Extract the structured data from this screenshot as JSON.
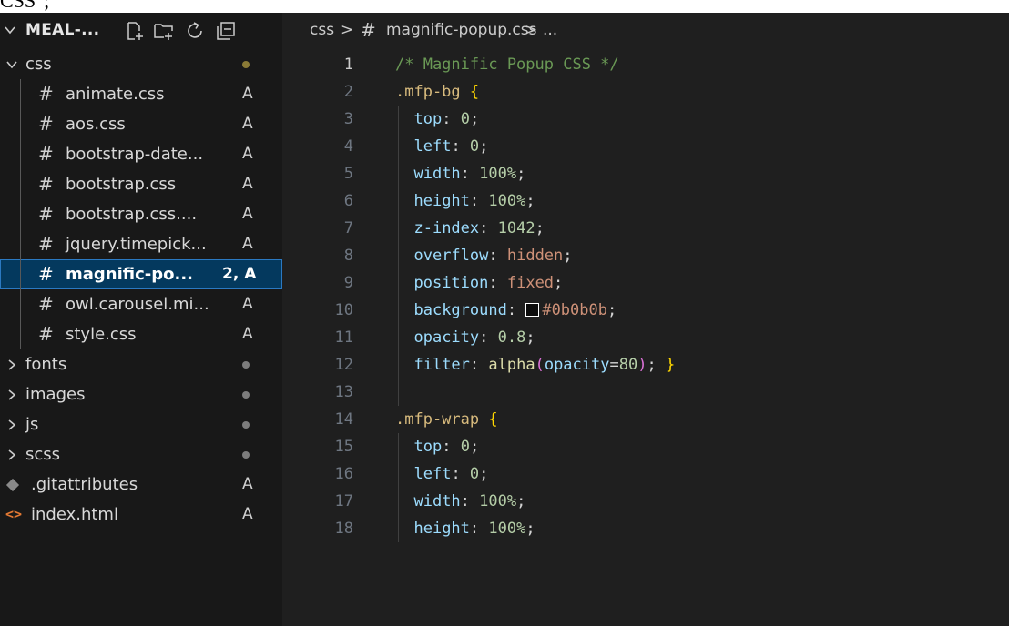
{
  "top_strip_text": "CSS\";",
  "explorer": {
    "title": "MEAL-...",
    "items": [
      {
        "kind": "folder-open",
        "name": "css",
        "status": "dot-modified"
      },
      {
        "kind": "file",
        "name": "animate.css",
        "badge": "A"
      },
      {
        "kind": "file",
        "name": "aos.css",
        "badge": "A"
      },
      {
        "kind": "file",
        "name": "bootstrap-date...",
        "badge": "A"
      },
      {
        "kind": "file",
        "name": "bootstrap.css",
        "badge": "A"
      },
      {
        "kind": "file",
        "name": "bootstrap.css....",
        "badge": "A"
      },
      {
        "kind": "file",
        "name": "jquery.timepick...",
        "badge": "A"
      },
      {
        "kind": "file",
        "name": "magnific-po...",
        "badge": "2, A",
        "selected": true
      },
      {
        "kind": "file",
        "name": "owl.carousel.mi...",
        "badge": "A"
      },
      {
        "kind": "file",
        "name": "style.css",
        "badge": "A"
      },
      {
        "kind": "folder",
        "name": "fonts",
        "status": "dot"
      },
      {
        "kind": "folder",
        "name": "images",
        "status": "dot"
      },
      {
        "kind": "folder",
        "name": "js",
        "status": "dot"
      },
      {
        "kind": "folder",
        "name": "scss",
        "status": "dot"
      },
      {
        "kind": "root-file",
        "name": ".gitattributes",
        "badge": "A",
        "icon": "git-icon"
      },
      {
        "kind": "root-file",
        "name": "index.html",
        "badge": "A",
        "icon": "html-icon"
      }
    ],
    "hash_glyph": "#"
  },
  "breadcrumb": {
    "folder": "css",
    "sep": ">",
    "hash": "#",
    "file": "magnific-popup.css",
    "tail": "..."
  },
  "editor": {
    "active_line": 1,
    "lines": [
      {
        "n": "1",
        "tokens": [
          [
            "t-comment",
            "/* Magnific Popup CSS */"
          ]
        ]
      },
      {
        "n": "2",
        "tokens": [
          [
            "t-sel",
            ".mfp-bg"
          ],
          [
            "t-punc",
            " "
          ],
          [
            "t-brace",
            "{"
          ]
        ]
      },
      {
        "n": "3",
        "tokens": [
          [
            "t-punc",
            "  "
          ],
          [
            "t-prop",
            "top"
          ],
          [
            "t-punc",
            ": "
          ],
          [
            "t-num",
            "0"
          ],
          [
            "t-punc",
            ";"
          ]
        ]
      },
      {
        "n": "4",
        "tokens": [
          [
            "t-punc",
            "  "
          ],
          [
            "t-prop",
            "left"
          ],
          [
            "t-punc",
            ": "
          ],
          [
            "t-num",
            "0"
          ],
          [
            "t-punc",
            ";"
          ]
        ]
      },
      {
        "n": "5",
        "tokens": [
          [
            "t-punc",
            "  "
          ],
          [
            "t-prop",
            "width"
          ],
          [
            "t-punc",
            ": "
          ],
          [
            "t-num",
            "100%"
          ],
          [
            "t-punc",
            ";"
          ]
        ]
      },
      {
        "n": "6",
        "tokens": [
          [
            "t-punc",
            "  "
          ],
          [
            "t-prop",
            "height"
          ],
          [
            "t-punc",
            ": "
          ],
          [
            "t-num",
            "100%"
          ],
          [
            "t-punc",
            ";"
          ]
        ]
      },
      {
        "n": "7",
        "tokens": [
          [
            "t-punc",
            "  "
          ],
          [
            "t-prop",
            "z-index"
          ],
          [
            "t-punc",
            ": "
          ],
          [
            "t-num",
            "1042"
          ],
          [
            "t-punc",
            ";"
          ]
        ]
      },
      {
        "n": "8",
        "tokens": [
          [
            "t-punc",
            "  "
          ],
          [
            "t-prop",
            "overflow"
          ],
          [
            "t-punc",
            ": "
          ],
          [
            "t-kw",
            "hidden"
          ],
          [
            "t-punc",
            ";"
          ]
        ]
      },
      {
        "n": "9",
        "tokens": [
          [
            "t-punc",
            "  "
          ],
          [
            "t-prop",
            "position"
          ],
          [
            "t-punc",
            ": "
          ],
          [
            "t-kw",
            "fixed"
          ],
          [
            "t-punc",
            ";"
          ]
        ]
      },
      {
        "n": "10",
        "tokens": [
          [
            "t-punc",
            "  "
          ],
          [
            "t-prop",
            "background"
          ],
          [
            "t-punc",
            ": "
          ],
          [
            "swatch",
            ""
          ],
          [
            "t-kw",
            "#0b0b0b"
          ],
          [
            "t-punc",
            ";"
          ]
        ]
      },
      {
        "n": "11",
        "tokens": [
          [
            "t-punc",
            "  "
          ],
          [
            "t-prop",
            "opacity"
          ],
          [
            "t-punc",
            ": "
          ],
          [
            "t-num",
            "0.8"
          ],
          [
            "t-punc",
            ";"
          ]
        ]
      },
      {
        "n": "12",
        "tokens": [
          [
            "t-punc",
            "  "
          ],
          [
            "t-prop",
            "filter"
          ],
          [
            "t-punc",
            ": "
          ],
          [
            "t-func",
            "alpha"
          ],
          [
            "t-paren",
            "("
          ],
          [
            "t-prop",
            "opacity"
          ],
          [
            "t-punc",
            "="
          ],
          [
            "t-num",
            "80"
          ],
          [
            "t-paren",
            ")"
          ],
          [
            "t-punc",
            "; "
          ],
          [
            "t-brace",
            "}"
          ]
        ]
      },
      {
        "n": "13",
        "tokens": []
      },
      {
        "n": "14",
        "tokens": [
          [
            "t-sel",
            ".mfp-wrap"
          ],
          [
            "t-punc",
            " "
          ],
          [
            "t-brace",
            "{"
          ]
        ]
      },
      {
        "n": "15",
        "tokens": [
          [
            "t-punc",
            "  "
          ],
          [
            "t-prop",
            "top"
          ],
          [
            "t-punc",
            ": "
          ],
          [
            "t-num",
            "0"
          ],
          [
            "t-punc",
            ";"
          ]
        ]
      },
      {
        "n": "16",
        "tokens": [
          [
            "t-punc",
            "  "
          ],
          [
            "t-prop",
            "left"
          ],
          [
            "t-punc",
            ": "
          ],
          [
            "t-num",
            "0"
          ],
          [
            "t-punc",
            ";"
          ]
        ]
      },
      {
        "n": "17",
        "tokens": [
          [
            "t-punc",
            "  "
          ],
          [
            "t-prop",
            "width"
          ],
          [
            "t-punc",
            ": "
          ],
          [
            "t-num",
            "100%"
          ],
          [
            "t-punc",
            ";"
          ]
        ]
      },
      {
        "n": "18",
        "tokens": [
          [
            "t-punc",
            "  "
          ],
          [
            "t-prop",
            "height"
          ],
          [
            "t-punc",
            ": "
          ],
          [
            "t-num",
            "100%"
          ],
          [
            "t-punc",
            ";"
          ]
        ]
      }
    ]
  }
}
